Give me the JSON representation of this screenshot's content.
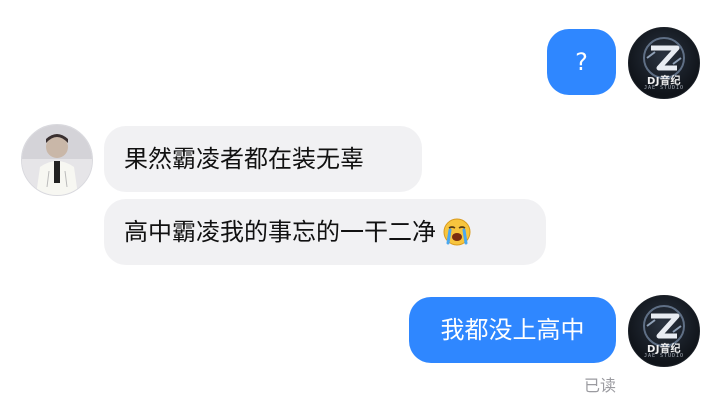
{
  "messages": [
    {
      "side": "out",
      "text": "?"
    },
    {
      "side": "in",
      "text": "果然霸凌者都在装无辜"
    },
    {
      "side": "in",
      "text": "高中霸凌我的事忘的一干二净",
      "emoji": "loudly-crying-face"
    },
    {
      "side": "out",
      "text": "我都没上高中"
    }
  ],
  "self_avatar": {
    "logo_text": "DJ音纪",
    "logo_sub": "JAE STUDIO"
  },
  "read_receipt": "已读",
  "colors": {
    "outgoing_bubble": "#2f87ff",
    "incoming_bubble": "#f1f1f3",
    "read_receipt": "#9b9ba0"
  }
}
